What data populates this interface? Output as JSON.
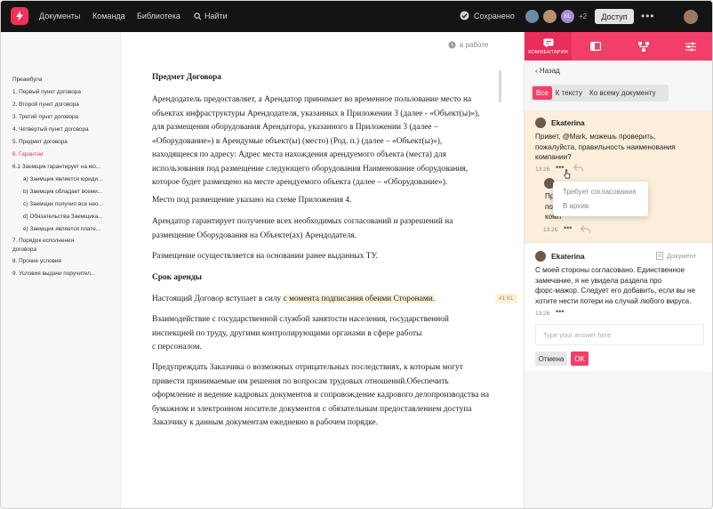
{
  "topbar": {
    "nav": [
      "Документы",
      "Команда",
      "Библиотека",
      "Найти"
    ],
    "saved": "Сохранено",
    "avatar_initials": "KL",
    "more_users": "+2",
    "access": "Доступ",
    "colors": {
      "bar": "#141414",
      "brand": "#f0325a"
    }
  },
  "toc": [
    "Преамбула",
    "1. Первый пункт договора",
    "2. Второй пункт договора",
    "3. Третий пункт договора",
    "4. Четвертый пункт договора",
    "5. Предмет договора",
    "6. Гарантии",
    "6.1 Заемщик гарантирует на мо...",
    "a) Заемщик является юриди...",
    "b) Заемщик обладает всеми...",
    "c) Заемщик получил все нео...",
    "d) Обязательства Заемщика...",
    "e) Заемщик является плате...",
    "7. Порядок исполнения договора",
    "8. Прочие условия",
    "9. Условия выдачи поручител..."
  ],
  "doc": {
    "status": "в работе",
    "h1": "Предмет Договора",
    "p1": [
      "Арендодатель предоставляет, а Арендатор принимает во временное пользование место на",
      "объектах инфраструктуры Арендодателя, указанных в Приложении 3 (далее - «Объект(ы)»),",
      "для размещения оборудования Арендатора, указанного в Приложении 3 (далее –",
      "«Оборудование») в Арендумые объект(ы) (место) (Род. п.) (далее – «Объект(ы)»),",
      "находящееся по адресу: Адрес места нахождения арендуемого объекта (места) для",
      "использования под размещение следующего оборудования Наименование оборудования,",
      "которое будет размещено на месте арендуемого объекта (далее – «Оборудование»)."
    ],
    "p2": "Место под размещение указано на схеме Приложения 4.",
    "p3": [
      "Арендатор гарантирует получение всех необходимых согласований и разрешений на",
      "размещение Оборудования на Объекте(ах) Арендодателя."
    ],
    "p4": "Размещение осуществляется на основании ранее выданных ТУ.",
    "h2": "Срок аренды",
    "p5_pre": "Настоящий Договор вступает в силу",
    "p5_hl": "с момента подписания обеими Сторонами.",
    "tag": "#1 KL",
    "p6": [
      "Взаимодействие с государственной службой занятости населения, государственной",
      "инспекцией по труду, другими контролирующими органами в сфере работы",
      "с персоналом."
    ],
    "p7": [
      "Предупреждать Заказчика о возможных отрицательных последствиях, к которым могут",
      "привести принимаемые им решения по вопросам трудовых отношений.Обеспечить",
      "оформление и ведение кадровых документов и сопровождение кадрового делопроизводства на",
      "бумажном и электронном носителе документов с обязательным предоставлением доступа",
      "Заказчику к данным документам ежедневно в рабочем порядке."
    ]
  },
  "panel": {
    "tab_label": "КОММЕНТАРИИ",
    "back": "Назад",
    "filters": [
      "Все",
      "К тексту",
      "Ко всему документу"
    ],
    "c1": {
      "name": "Ekaterina",
      "text": [
        "Привет, @Mark, можешь проверить,",
        "пожалуйста, правильность наименования",
        "компании?"
      ],
      "time": "13:26",
      "reply_text": [
        "Привет,",
        "поже",
        "комп"
      ],
      "reply_time": "13:26"
    },
    "menu": [
      "Требует согласования",
      "В архив"
    ],
    "c2": {
      "name": "Ekaterina",
      "scope": "Документ",
      "text": [
        "С моей стороны согласовано. Единственное",
        "замечание, я не увидела раздела про",
        "форс-мажор. Следует его добавить, если вы не",
        "хотите нести потери на случай любого вируса."
      ],
      "time": "13:26"
    },
    "input_placeholder": "Type your answer here",
    "cancel": "Отмена",
    "ok": "OK"
  }
}
